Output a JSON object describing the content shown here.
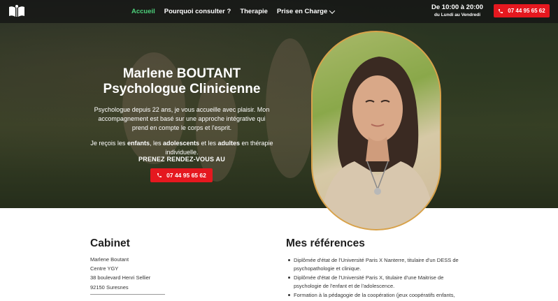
{
  "header": {
    "logo_icon": "logo-icon",
    "nav": [
      {
        "label": "Accueil",
        "active": true
      },
      {
        "label": "Pourquoi consulter ?",
        "active": false
      },
      {
        "label": "Therapie",
        "active": false
      },
      {
        "label": "Prise en Charge",
        "active": false,
        "dropdown": true
      }
    ],
    "hours_line1": "De 10:00 à 20:00",
    "hours_line2": "du Lundi au Vendredi",
    "phone": "07 44 95 65 62",
    "phone_icon": "phone-icon"
  },
  "hero": {
    "name": "Marlene BOUTANT",
    "role": "Psychologue Clinicienne",
    "intro": "Psychologue depuis 22 ans, je vous accueille avec plaisir. Mon accompagnement est basé sur une approche intégrative qui prend en compte le corps et l'esprit.",
    "receive_prefix": "Je reçois les ",
    "receive_children": "enfants",
    "receive_sep1": ", les ",
    "receive_teens": "adolescents",
    "receive_sep2": " et les ",
    "receive_adults": "adultes",
    "receive_suffix": " en thérapie individuelle.",
    "cta_label": "PRENEZ RENDEZ-VOUS AU",
    "phone": "07 44 95 65 62",
    "accent_color": "#e5181f",
    "nav_active_color": "#4cd07a",
    "portrait_border_color": "#d8a24a"
  },
  "cabinet": {
    "title": "Cabinet",
    "lines": [
      "Marlene Boutant",
      "Centre YGY",
      "38 boulevard Henri Sellier",
      "92150 Suresnes"
    ]
  },
  "references": {
    "title": "Mes références",
    "items": [
      "Diplômée d'état de l'Université Paris X Nanterre, titulaire d'un DESS de psychopathologie et clinique.",
      "Diplômée d'état de l'Université Paris X, titulaire d'une Maitrise de psychologie de l'enfant et de l'adolescence.",
      "Formation à la pédagogie de la coopération (jeux coopératifs enfants,"
    ]
  }
}
